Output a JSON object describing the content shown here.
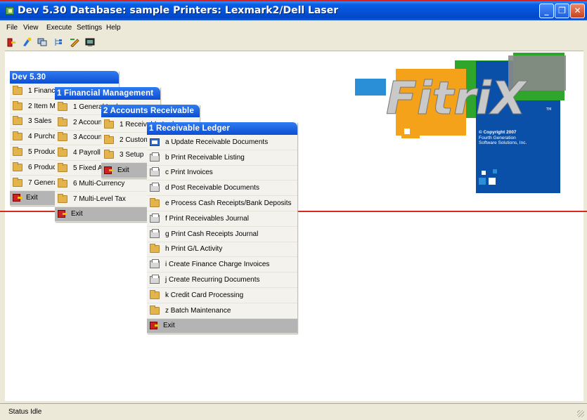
{
  "window": {
    "title": "Dev 5.30 Database: sample Printers: Lexmark2/Dell Laser",
    "minimize_glyph": "_",
    "restore_glyph": "❐",
    "close_glyph": "✕"
  },
  "menubar": {
    "items": [
      "File",
      "View",
      "Execute",
      "Settings",
      "Help"
    ]
  },
  "toolbar": {
    "icons": [
      "exit-icon",
      "paint-icon",
      "windows-icon",
      "tree-icon",
      "edit-icon",
      "terminal-icon"
    ]
  },
  "menus": {
    "dev": {
      "title": "Dev 5.30",
      "items": [
        "1 Financial Management",
        "2 Item Management",
        "3 Sales",
        "4 Purchasing",
        "5 Production",
        "6 Production",
        "7 General"
      ],
      "exit": "Exit"
    },
    "financial": {
      "title": "1 Financial Management",
      "items": [
        "1 General Ledger",
        "2 Accounts Receivable",
        "3 Accounts Payable",
        "4 Payroll",
        "5 Fixed Assets",
        "6 Multi-Currency",
        "7 Multi-Level Tax"
      ],
      "exit": "Exit"
    },
    "receivable": {
      "title": "2 Accounts Receivable",
      "items": [
        "1 Receivable Ledger",
        "2 Customers",
        "3 Setup"
      ],
      "exit": "Exit"
    },
    "ledger": {
      "title": "1 Receivable Ledger",
      "items": [
        {
          "label": "a Update Receivable Documents",
          "icon": "document-icon"
        },
        {
          "label": "b Print Receivable Listing",
          "icon": "printer-icon"
        },
        {
          "label": "c Print Invoices",
          "icon": "printer-icon"
        },
        {
          "label": "d Post Receivable Documents",
          "icon": "printer-icon"
        },
        {
          "label": "e Process Cash Receipts/Bank Deposits",
          "icon": "folder-icon"
        },
        {
          "label": "f Print Receivables Journal",
          "icon": "printer-icon"
        },
        {
          "label": "g Print Cash Receipts Journal",
          "icon": "printer-icon"
        },
        {
          "label": "h Print G/L Activity",
          "icon": "folder-icon"
        },
        {
          "label": "i Create Finance Charge Invoices",
          "icon": "printer-icon"
        },
        {
          "label": "j Create Recurring Documents",
          "icon": "printer-icon"
        },
        {
          "label": "k Credit Card Processing",
          "icon": "folder-icon"
        },
        {
          "label": "z Batch Maintenance",
          "icon": "folder-icon"
        }
      ],
      "exit": "Exit"
    }
  },
  "logo": {
    "text": "FitriX",
    "trademark": "TM",
    "copyright_lines": [
      "© Copyright 2007",
      "Fourth Generation",
      "Software Solutions, Inc."
    ],
    "colors": {
      "blue": "#0a4fa8",
      "green": "#2fa52b",
      "orange": "#f4a21a",
      "gray": "#8a8a8a",
      "teal": "#2a8fd6"
    }
  },
  "status": {
    "text": "Status  Idle"
  }
}
